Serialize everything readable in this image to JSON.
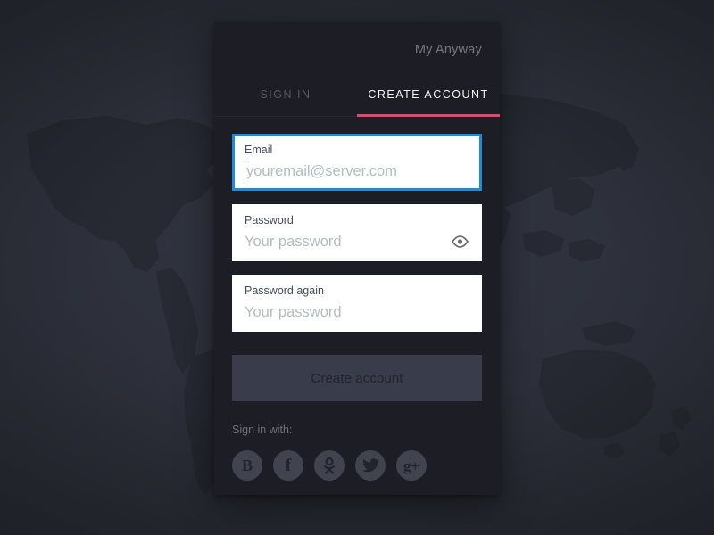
{
  "brand": {
    "title": "My Anyway"
  },
  "tabs": [
    {
      "label": "SIGN IN",
      "active": false
    },
    {
      "label": "CREATE ACCOUNT",
      "active": true
    }
  ],
  "form": {
    "fields": [
      {
        "name": "email",
        "label": "Email",
        "placeholder": "youremail@server.com",
        "value": "",
        "focused": true,
        "has_toggle": false
      },
      {
        "name": "password",
        "label": "Password",
        "placeholder": "Your password",
        "value": "",
        "focused": false,
        "has_toggle": true,
        "toggle_icon": "eye-icon"
      },
      {
        "name": "password-again",
        "label": "Password again",
        "placeholder": "Your password",
        "value": "",
        "focused": false,
        "has_toggle": false
      }
    ],
    "submit_label": "Create account"
  },
  "social": {
    "label": "Sign in with:",
    "providers": [
      {
        "name": "vk",
        "icon": "vk-icon",
        "glyph": "В"
      },
      {
        "name": "facebook",
        "icon": "facebook-icon",
        "glyph": "f"
      },
      {
        "name": "odnoklassniki",
        "icon": "odnoklassniki-icon",
        "glyph": "OK"
      },
      {
        "name": "twitter",
        "icon": "twitter-icon",
        "glyph": ""
      },
      {
        "name": "google-plus",
        "icon": "google-plus-icon",
        "glyph": "g+"
      }
    ]
  },
  "colors": {
    "accent_pink": "#e8456e",
    "focus_blue": "#1f8ad8",
    "card_bg": "#1d1e25",
    "button_bg": "#393c4a",
    "page_bg": "#2b2e38"
  }
}
